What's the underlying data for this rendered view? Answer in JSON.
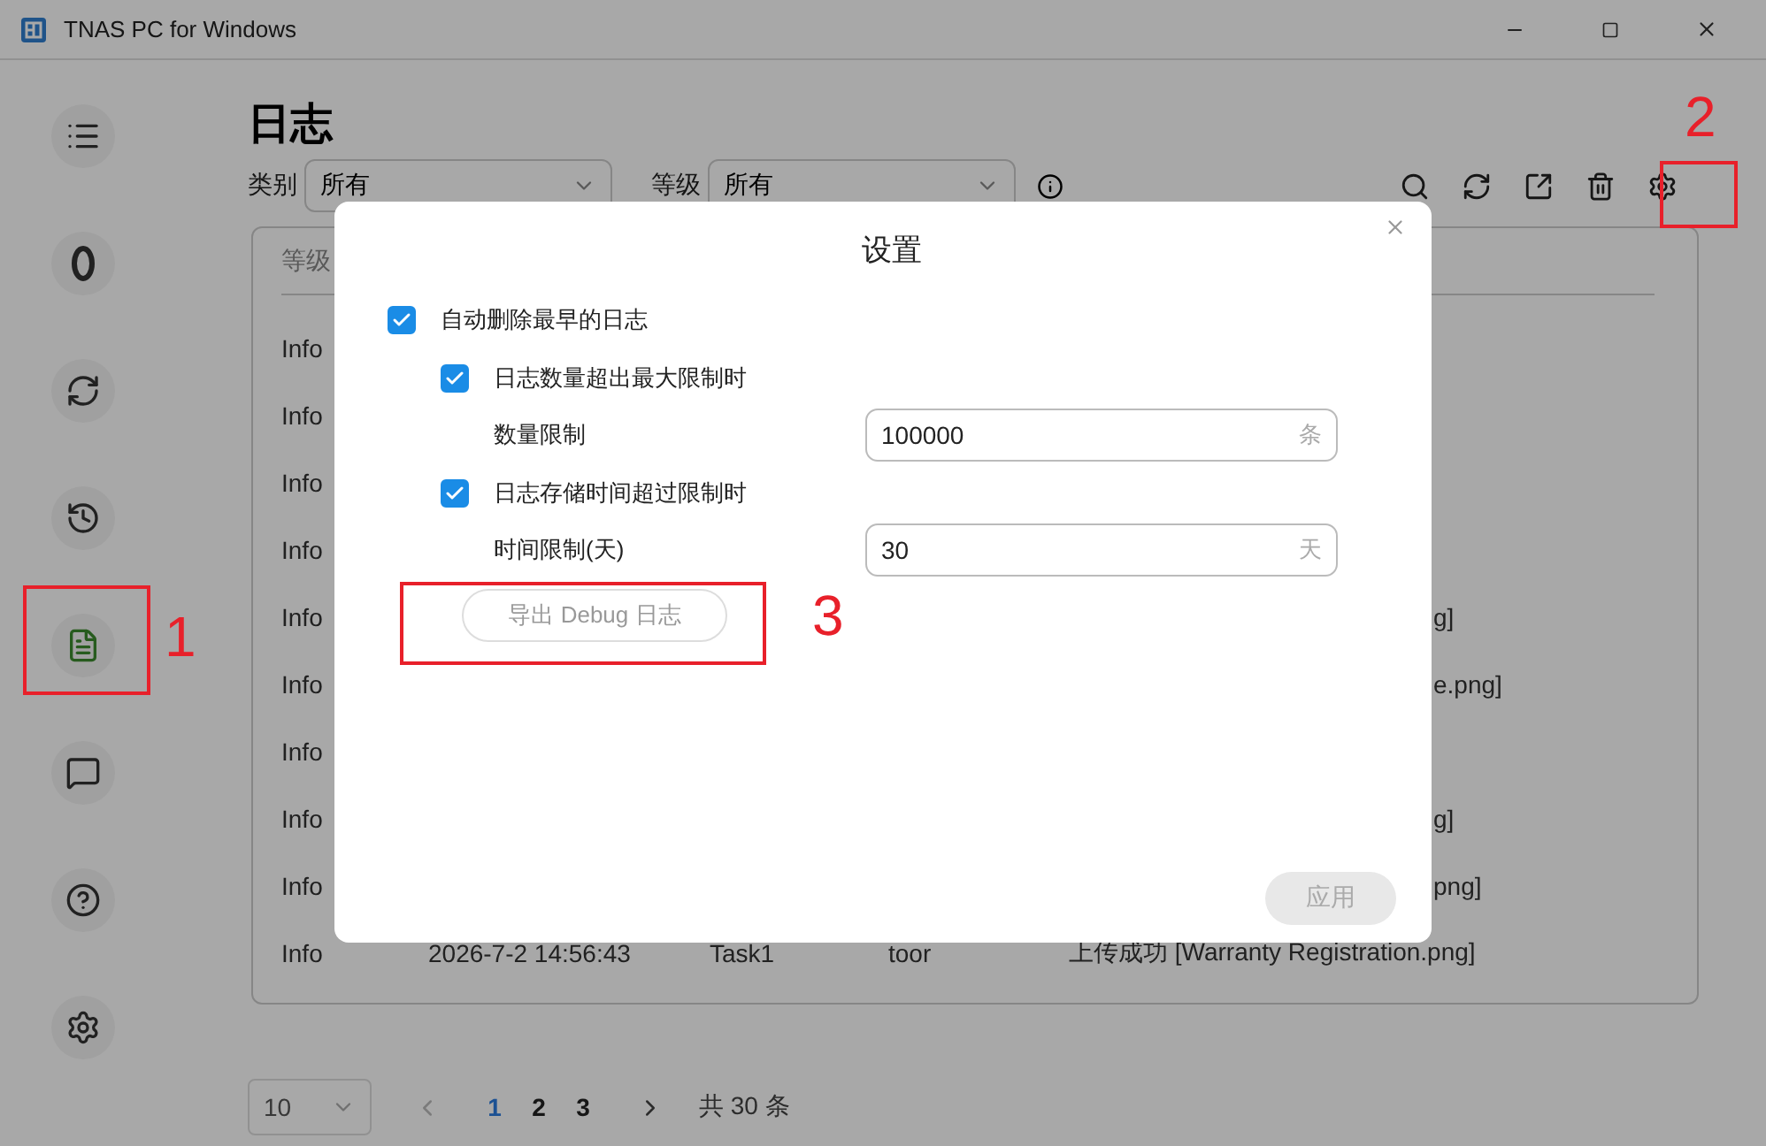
{
  "window": {
    "title": "TNAS PC for Windows"
  },
  "sidebar": {
    "items": [
      {
        "selected": false
      },
      {
        "selected": false
      },
      {
        "selected": false
      },
      {
        "selected": false
      },
      {
        "selected": true
      },
      {
        "selected": false
      },
      {
        "selected": false
      },
      {
        "selected": false
      }
    ]
  },
  "page": {
    "title": "日志",
    "filters": [
      {
        "label": "类别",
        "value": "所有"
      },
      {
        "label": "等级",
        "value": "所有"
      }
    ]
  },
  "table": {
    "columns": [
      "等级"
    ],
    "rows": [
      {
        "level": "Info"
      },
      {
        "level": "Info"
      },
      {
        "level": "Info"
      },
      {
        "level": "Info"
      },
      {
        "level": "Info",
        "message": "g]"
      },
      {
        "level": "Info",
        "message": "e.png]"
      },
      {
        "level": "Info"
      },
      {
        "level": "Info",
        "message": "g]"
      },
      {
        "level": "Info",
        "message": "png]"
      },
      {
        "level": "Info",
        "time": "2026-7-2 14:56:43",
        "task": "Task1",
        "user": "toor",
        "message": "上传成功 [Warranty Registration.png]"
      }
    ]
  },
  "pagination": {
    "page_size": "10",
    "pages": [
      {
        "label": "1",
        "selected": true
      },
      {
        "label": "2",
        "selected": false
      },
      {
        "label": "3",
        "selected": false
      }
    ],
    "total": "共 30 条"
  },
  "dialog": {
    "title": "设置",
    "options": [
      {
        "kind": "checkbox",
        "label": "自动删除最早的日志",
        "checked": true,
        "children": [
          {
            "kind": "checkbox",
            "label": "日志数量超出最大限制时",
            "checked": true
          },
          {
            "kind": "field",
            "label": "数量限制",
            "value": "100000",
            "unit": "条"
          },
          {
            "kind": "checkbox",
            "label": "日志存储时间超过限制时",
            "checked": true
          },
          {
            "kind": "field",
            "label": "时间限制(天)",
            "value": "30",
            "unit": "天"
          }
        ]
      }
    ],
    "export_button": "导出 Debug 日志",
    "apply_button": {
      "label": "应用",
      "disabled": true
    }
  },
  "annotations": [
    "1",
    "2",
    "3"
  ]
}
